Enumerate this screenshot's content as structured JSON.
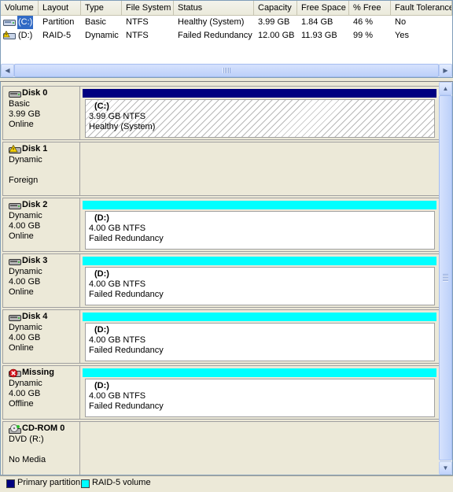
{
  "colors": {
    "primary_partition": "#000080",
    "raid5_volume": "#00ffff",
    "selection": "#316ac5"
  },
  "volume_list": {
    "columns": [
      "Volume",
      "Layout",
      "Type",
      "File System",
      "Status",
      "Capacity",
      "Free Space",
      "% Free",
      "Fault Tolerance"
    ],
    "rows": [
      {
        "icon": "drive-icon",
        "volume": "(C:)",
        "layout": "Partition",
        "type": "Basic",
        "file_system": "NTFS",
        "status": "Healthy (System)",
        "capacity": "3.99 GB",
        "free_space": "1.84 GB",
        "percent_free": "46 %",
        "fault_tolerance": "No",
        "selected": true
      },
      {
        "icon": "drive-warning-icon",
        "volume": "(D:)",
        "layout": "RAID-5",
        "type": "Dynamic",
        "file_system": "NTFS",
        "status": "Failed Redundancy",
        "capacity": "12.00 GB",
        "free_space": "11.93 GB",
        "percent_free": "99 %",
        "fault_tolerance": "Yes",
        "selected": false
      }
    ]
  },
  "disks": [
    {
      "name": "Disk 0",
      "icon": "disk-icon",
      "line1": "Basic",
      "line2": "3.99 GB",
      "line3": "Online",
      "partition": {
        "style": "primary",
        "label": "(C:)",
        "size": "3.99 GB NTFS",
        "status": "Healthy (System)"
      }
    },
    {
      "name": "Disk 1",
      "icon": "disk-foreign-icon",
      "line1": "Dynamic",
      "line2": "",
      "line3": "Foreign",
      "partition": null
    },
    {
      "name": "Disk 2",
      "icon": "disk-icon",
      "line1": "Dynamic",
      "line2": "4.00 GB",
      "line3": "Online",
      "partition": {
        "style": "raid5",
        "label": "(D:)",
        "size": "4.00 GB NTFS",
        "status": "Failed Redundancy"
      }
    },
    {
      "name": "Disk 3",
      "icon": "disk-icon",
      "line1": "Dynamic",
      "line2": "4.00 GB",
      "line3": "Online",
      "partition": {
        "style": "raid5",
        "label": "(D:)",
        "size": "4.00 GB NTFS",
        "status": "Failed Redundancy"
      }
    },
    {
      "name": "Disk 4",
      "icon": "disk-icon",
      "line1": "Dynamic",
      "line2": "4.00 GB",
      "line3": "Online",
      "partition": {
        "style": "raid5",
        "label": "(D:)",
        "size": "4.00 GB NTFS",
        "status": "Failed Redundancy"
      }
    },
    {
      "name": "Missing",
      "icon": "disk-missing-icon",
      "line1": "Dynamic",
      "line2": "4.00 GB",
      "line3": "Offline",
      "partition": {
        "style": "raid5",
        "label": "(D:)",
        "size": "4.00 GB NTFS",
        "status": "Failed Redundancy"
      }
    },
    {
      "name": "CD-ROM 0",
      "icon": "cdrom-icon",
      "line1": "DVD (R:)",
      "line2": "",
      "line3": "No Media",
      "partition": null
    }
  ],
  "legend": [
    {
      "label": "Primary partition",
      "color": "#000080"
    },
    {
      "label": "RAID-5 volume",
      "color": "#00ffff"
    }
  ]
}
